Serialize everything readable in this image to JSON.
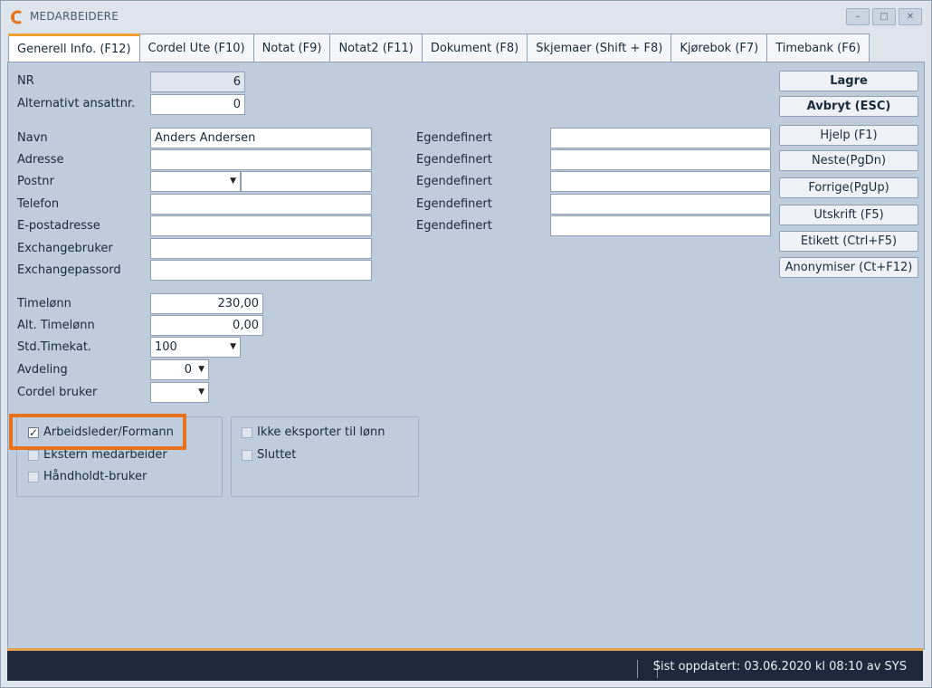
{
  "window": {
    "title": "MEDARBEIDERE",
    "min": "–",
    "max": "□",
    "close": "✕"
  },
  "tabs": [
    {
      "label": "Generell Info. (F12)"
    },
    {
      "label": "Cordel Ute (F10)"
    },
    {
      "label": "Notat (F9)"
    },
    {
      "label": "Notat2 (F11)"
    },
    {
      "label": "Dokument (F8)"
    },
    {
      "label": "Skjemaer (Shift + F8)"
    },
    {
      "label": "Kjørebok (F7)"
    },
    {
      "label": "Timebank (F6)"
    }
  ],
  "fields": {
    "nr": {
      "label": "NR",
      "value": "6"
    },
    "alt_ansattnr": {
      "label": "Alternativt ansattnr.",
      "value": "0"
    },
    "navn": {
      "label": "Navn",
      "value": "Anders Andersen"
    },
    "adresse": {
      "label": "Adresse",
      "value": ""
    },
    "postnr": {
      "label": "Postnr",
      "value": "",
      "city": ""
    },
    "telefon": {
      "label": "Telefon",
      "value": ""
    },
    "epost": {
      "label": "E-postadresse",
      "value": ""
    },
    "exchangebruker": {
      "label": "Exchangebruker",
      "value": ""
    },
    "exchangepassord": {
      "label": "Exchangepassord",
      "value": ""
    },
    "timelonn": {
      "label": "Timelønn",
      "value": "230,00"
    },
    "alt_timelonn": {
      "label": "Alt. Timelønn",
      "value": "0,00"
    },
    "std_timekat": {
      "label": "Std.Timekat.",
      "value": "100"
    },
    "avdeling": {
      "label": "Avdeling",
      "value": "0"
    },
    "cordel_bruker": {
      "label": "Cordel bruker",
      "value": ""
    }
  },
  "custom": [
    {
      "label": "Egendefinert",
      "value": ""
    },
    {
      "label": "Egendefinert",
      "value": ""
    },
    {
      "label": "Egendefinert",
      "value": ""
    },
    {
      "label": "Egendefinert",
      "value": ""
    },
    {
      "label": "Egendefinert",
      "value": ""
    }
  ],
  "buttons": {
    "lagre": "Lagre",
    "avbryt": "Avbryt (ESC)",
    "hjelp": "Hjelp (F1)",
    "neste": "Neste(PgDn)",
    "forrige": "Forrige(PgUp)",
    "utskrift": "Utskrift (F5)",
    "etikett": "Etikett (Ctrl+F5)",
    "anonymiser": "Anonymiser (Ct+F12)"
  },
  "checks": {
    "arbeidsleder": {
      "label": "Arbeidsleder/Formann",
      "checked": true
    },
    "ekstern": {
      "label": "Ekstern medarbeider",
      "checked": false
    },
    "handholdt": {
      "label": "Håndholdt-bruker",
      "checked": false
    },
    "ikke_eksporter": {
      "label": "Ikke eksporter til lønn",
      "checked": false
    },
    "sluttet": {
      "label": "Sluttet",
      "checked": false
    }
  },
  "status": {
    "text": "Sist oppdatert: 03.06.2020 kl 08:10 av SYS"
  },
  "colors": {
    "accent": "#f0a030",
    "highlight": "#e8711c",
    "panel": "#bfccdb",
    "statusbar": "#1e2a3c"
  }
}
